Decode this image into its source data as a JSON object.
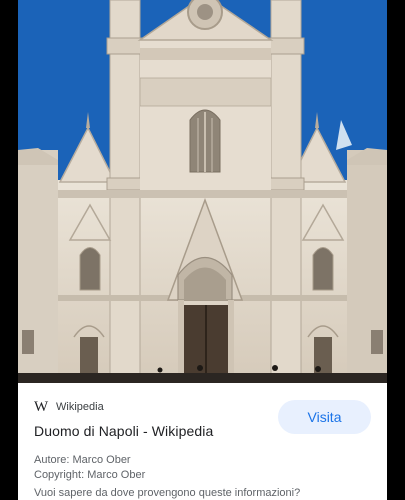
{
  "image": {
    "subject": "cathedral-facade",
    "colors": {
      "sky": "#1b63b8",
      "stone": "#e6ddd0",
      "shadow": "#9d9284",
      "door": "#4a3c30"
    }
  },
  "card": {
    "source": {
      "icon": "wikipedia-w-icon",
      "icon_glyph": "W",
      "name": "Wikipedia"
    },
    "title": "Duomo di Napoli - Wikipedia",
    "visit_label": "Visita",
    "author": "Autore: Marco Ober",
    "copyright": "Copyright: Marco Ober",
    "question": "Vuoi sapere da dove provengono queste informazioni?"
  },
  "colors": {
    "accent": "#1a73e8",
    "button_bg": "#e8f0fe",
    "card_bg": "#ffffff"
  }
}
